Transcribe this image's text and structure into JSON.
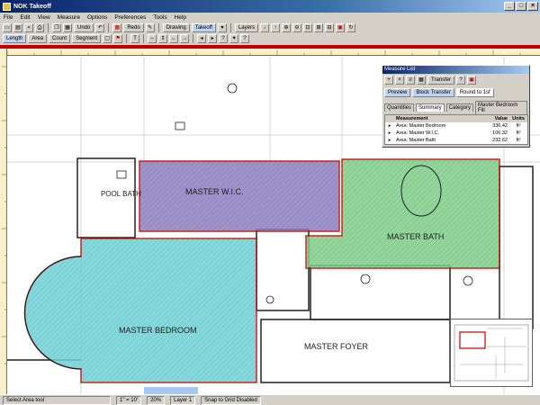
{
  "window": {
    "title": "NOK Takeoff"
  },
  "menu": [
    "File",
    "Edit",
    "View",
    "Measure",
    "Options",
    "Preferences",
    "Tools",
    "Help"
  ],
  "toolbar1": {
    "undo_label": "Undo",
    "redo_label": "Redo",
    "drawing_label": "Drawing",
    "takeoff_label": "Takeoff",
    "layers_label": "Layers"
  },
  "toolbar2": {
    "length_label": "Length",
    "area_label": "Area",
    "count_label": "Count",
    "segment_label": "Segment"
  },
  "rooms": {
    "master_wic": "MASTER W.I.C.",
    "pool_bath": "POOL BATH",
    "master_bath": "MASTER BATH",
    "master_bedroom": "MASTER BEDROOM",
    "master_foyer": "MASTER FOYER"
  },
  "panel": {
    "title": "Measure List",
    "transfer_label": "Transfer",
    "preview_label": "Preview",
    "block_transfer_label": "Block Transfer",
    "round_select": "Round to 1sf",
    "tabs": [
      "Quantities",
      "Summary",
      "Category",
      "Master Bedroom Fill"
    ],
    "columns": [
      "Measurement",
      "Value",
      "Units"
    ],
    "rows": [
      {
        "name": "Area: Master Bedroom",
        "value": "336.42",
        "units": "ft²"
      },
      {
        "name": "Area: Master W.I.C.",
        "value": "106.32",
        "units": "ft²"
      },
      {
        "name": "Area: Master Bath",
        "value": "232.62",
        "units": "ft²"
      }
    ]
  },
  "status": {
    "left": "Select Area tool",
    "scale": "1\" = 10'",
    "zoom": "20%",
    "layer": "Layer 1",
    "right": "Snap to Grid Disabled"
  },
  "colors": {
    "wic": "#8c7fc2",
    "bath": "#7fd08a",
    "bedroom": "#6fd3d8",
    "outline": "#c00000"
  }
}
